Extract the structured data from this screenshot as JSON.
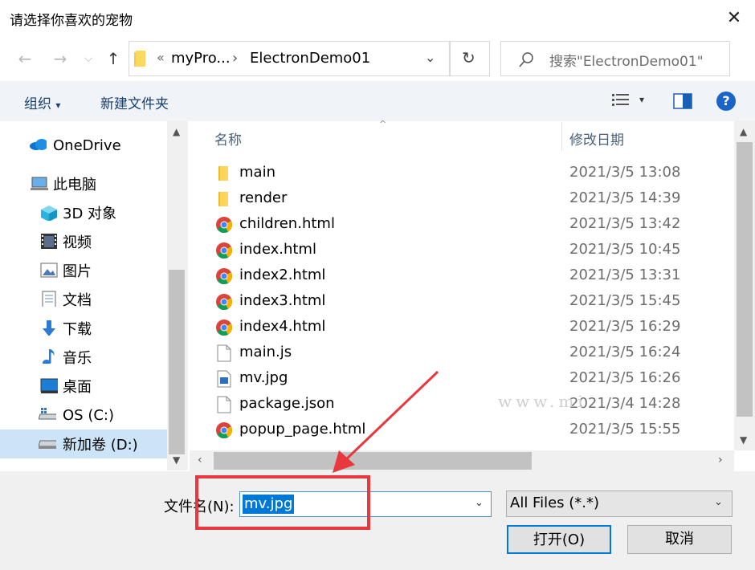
{
  "window": {
    "title": "请选择你喜欢的宠物",
    "close_label": "✕"
  },
  "address": {
    "overflow": "«",
    "crumbs": [
      "myPro...",
      "ElectronDemo01"
    ],
    "separator": "›"
  },
  "search": {
    "placeholder": "搜索\"ElectronDemo01\""
  },
  "toolbar": {
    "organize_label": "组织",
    "new_folder_label": "新建文件夹",
    "help_label": "?"
  },
  "sidebar": {
    "items": [
      {
        "label": "OneDrive",
        "icon": "cloud-icon"
      },
      {
        "label": "此电脑",
        "icon": "computer-icon"
      },
      {
        "label": "3D 对象",
        "icon": "cube-icon"
      },
      {
        "label": "视频",
        "icon": "video-icon"
      },
      {
        "label": "图片",
        "icon": "picture-icon"
      },
      {
        "label": "文档",
        "icon": "document-icon"
      },
      {
        "label": "下载",
        "icon": "download-icon"
      },
      {
        "label": "音乐",
        "icon": "music-icon"
      },
      {
        "label": "桌面",
        "icon": "desktop-icon"
      },
      {
        "label": "OS (C:)",
        "icon": "drive-c-icon"
      },
      {
        "label": "新加卷 (D:)",
        "icon": "drive-d-icon"
      }
    ]
  },
  "filelist": {
    "columns": {
      "name": "名称",
      "modified": "修改日期"
    },
    "rows": [
      {
        "name": "main",
        "date": "2021/3/5 13:08",
        "type": "folder"
      },
      {
        "name": "render",
        "date": "2021/3/5 14:39",
        "type": "folder"
      },
      {
        "name": "children.html",
        "date": "2021/3/5 13:42",
        "type": "chrome"
      },
      {
        "name": "index.html",
        "date": "2021/3/5 10:45",
        "type": "chrome"
      },
      {
        "name": "index2.html",
        "date": "2021/3/5 13:31",
        "type": "chrome"
      },
      {
        "name": "index3.html",
        "date": "2021/3/5 15:45",
        "type": "chrome"
      },
      {
        "name": "index4.html",
        "date": "2021/3/5 16:29",
        "type": "chrome"
      },
      {
        "name": "main.js",
        "date": "2021/3/5 16:24",
        "type": "file"
      },
      {
        "name": "mv.jpg",
        "date": "2021/3/5 16:26",
        "type": "image"
      },
      {
        "name": "package.json",
        "date": "2021/3/4 14:28",
        "type": "file"
      },
      {
        "name": "popup_page.html",
        "date": "2021/3/5 15:55",
        "type": "chrome"
      }
    ]
  },
  "bottom": {
    "filename_label": "文件名(N):",
    "filename_value": "mv.jpg",
    "filter_value": "All Files (*.*)",
    "open_label": "打开(O)",
    "cancel_label": "取消"
  },
  "watermark": "www.mi",
  "colors": {
    "accent": "#0078d7",
    "highlight_box": "#e8383d",
    "arrow": "#e8383d"
  }
}
